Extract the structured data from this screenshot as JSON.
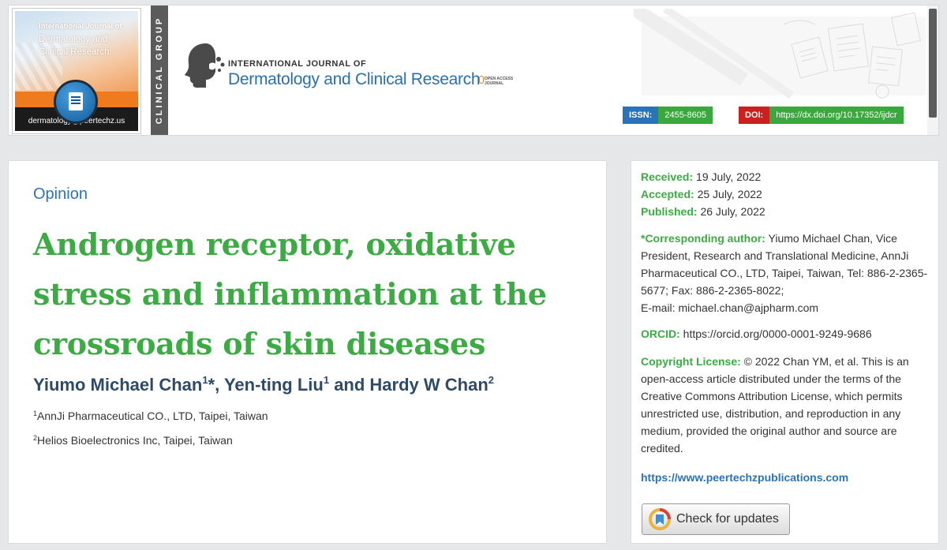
{
  "header": {
    "cover": {
      "title_line1": "International Journal of",
      "title_line2": "Dermatology and",
      "title_line3": "Clinical Research",
      "email": "dermatology@peertechz.us"
    },
    "side_label": "CLINICAL GROUP",
    "logo": {
      "small_text": "INTERNATIONAL JOURNAL OF",
      "big_text": "Dermatology and Clinical Research",
      "oa_line1": "OPEN ACCESS",
      "oa_line2": "JOURNAL"
    },
    "issn": {
      "label": "ISSN:",
      "value": "2455-8605"
    },
    "doi": {
      "label": "DOI:",
      "value": "https://dx.doi.org/10.17352/ijdcr"
    }
  },
  "article": {
    "type": "Opinion",
    "title_line1": "Androgen receptor, oxidative",
    "title_line2": "stress and inflammation at the",
    "title_line3": "crossroads of skin diseases",
    "authors": {
      "a1": "Yiumo Michael Chan",
      "a1_sup": "1",
      "star": "*, ",
      "a2": "Yen-ting Liu",
      "a2_sup": "1",
      "and": " and ",
      "a3": "Hardy W Chan",
      "a3_sup": "2"
    },
    "affiliations": [
      {
        "sup": "1",
        "text": "AnnJi Pharmaceutical CO., LTD, Taipei, Taiwan"
      },
      {
        "sup": "2",
        "text": "Helios Bioelectronics Inc, Taipei, Taiwan"
      }
    ]
  },
  "sidebar": {
    "received_label": "Received:",
    "received_value": " 19 July, 2022",
    "accepted_label": "Accepted:",
    "accepted_value": " 25 July, 2022",
    "published_label": "Published:",
    "published_value": " 26 July, 2022",
    "corr_label": "*Corresponding author:",
    "corr_text": " Yiumo Michael Chan,  Vice President, Research and Translational Medicine, AnnJi Pharmaceutical CO., LTD, Taipei, Taiwan, Tel: 886-2-2365-5677; Fax: 886-2-2365-8022;",
    "email_label": "E-mail: ",
    "email_value": "michael.chan@ajpharm.com",
    "orcid_label": "ORCID:",
    "orcid_value": " https://orcid.org/0000-0001-9249-9686",
    "copyright_label": "Copyright License:",
    "copyright_text": " © 2022  Chan YM, et al. This is an open-access article distributed under the terms of the Creative Commons Attribution License, which permits unrestricted use, distribution, and reproduction in any medium, provided the original author and source are credited.",
    "publisher_link": "https://www.peertechzpublications.com",
    "check_updates": "Check for updates"
  },
  "colors": {
    "title_green": "#3cab44",
    "accent_blue": "#2b73b8",
    "author_navy": "#2e4a6a",
    "doi_red": "#cc1f1f",
    "cover_orange": "#f07b1e"
  }
}
